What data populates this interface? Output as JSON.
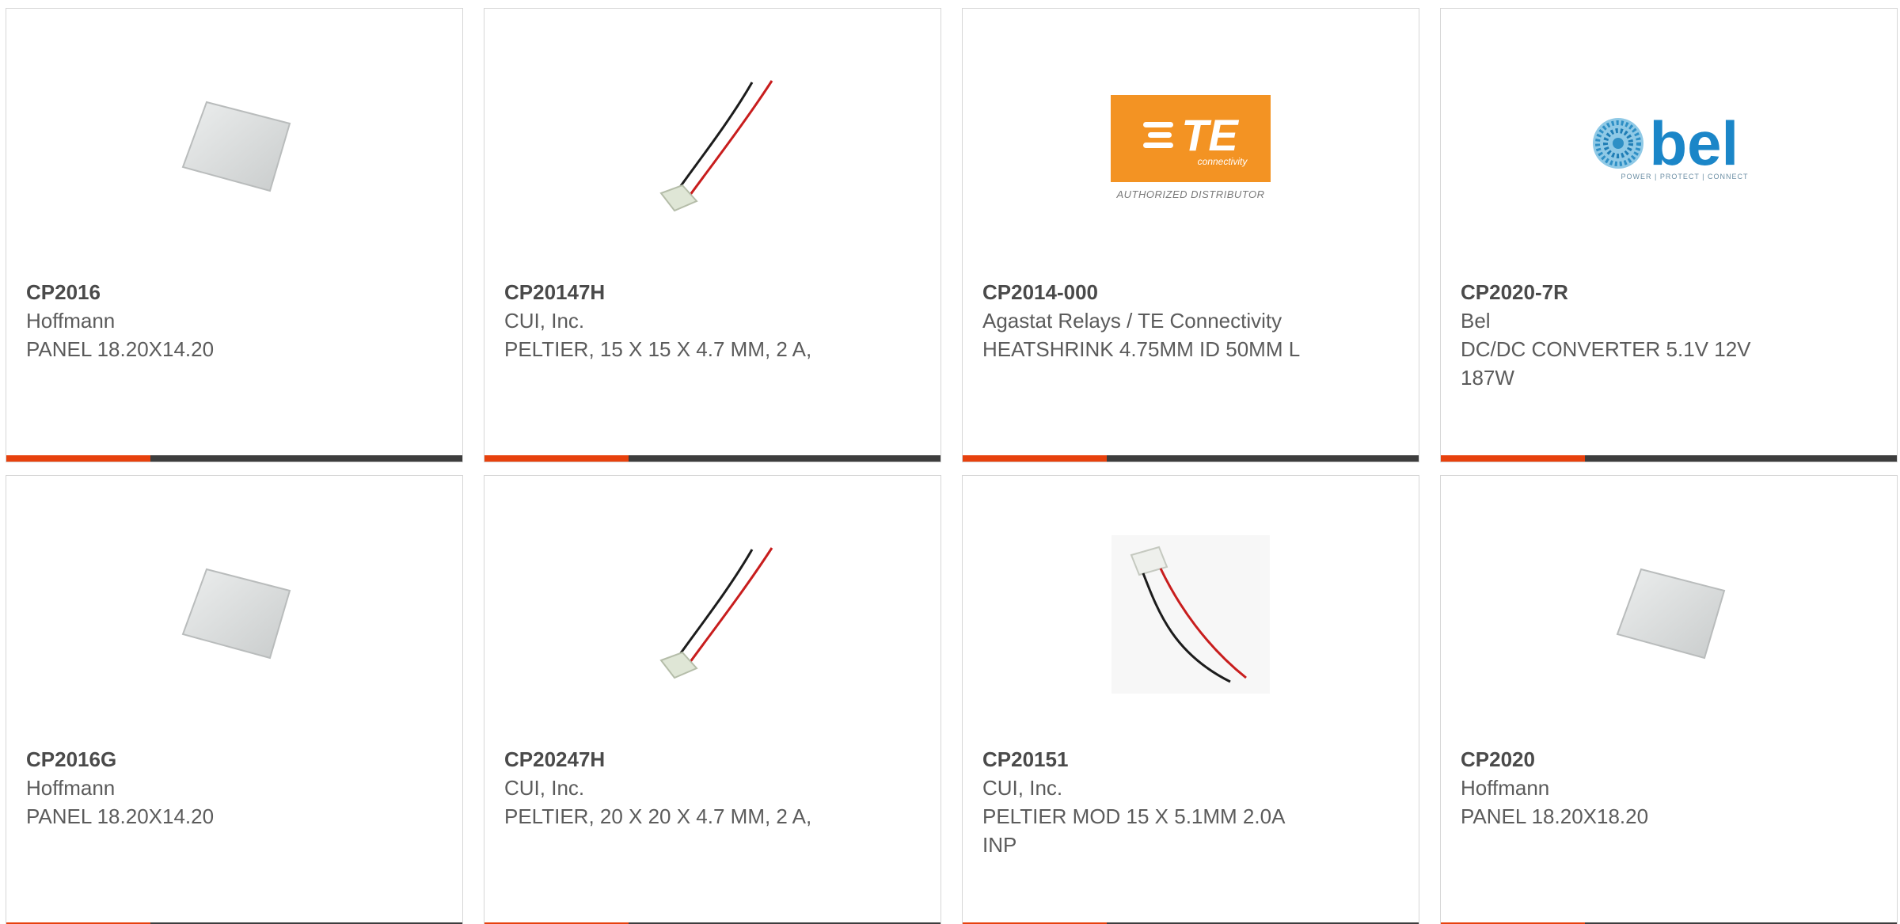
{
  "accent_color": "#e7410d",
  "bar_color": "#3d3d3d",
  "products": [
    {
      "part": "CP2016",
      "maker": "Hoffmann",
      "desc": "PANEL 18.20X14.20",
      "image": "panel-image"
    },
    {
      "part": "CP20147H",
      "maker": "CUI, Inc.",
      "desc": "PELTIER, 15 X 15 X 4.7 MM, 2 A,",
      "image": "peltier-image"
    },
    {
      "part": "CP2014-000",
      "maker": "Agastat Relays / TE Connectivity",
      "desc": "HEATSHRINK 4.75MM ID 50MM L",
      "image": "te-logo",
      "logo_text": "TE",
      "logo_sub": "connectivity",
      "logo_caption": "AUTHORIZED DISTRIBUTOR"
    },
    {
      "part": "CP2020-7R",
      "maker": "Bel",
      "desc": "DC/DC CONVERTER 5.1V 12V 187W",
      "image": "bel-logo",
      "logo_text": "bel",
      "logo_caption": "POWER | PROTECT | CONNECT"
    },
    {
      "part": "CP2016G",
      "maker": "Hoffmann",
      "desc": "PANEL 18.20X14.20",
      "image": "panel-image"
    },
    {
      "part": "CP20247H",
      "maker": "CUI, Inc.",
      "desc": "PELTIER, 20 X 20 X 4.7 MM, 2 A,",
      "image": "peltier-image"
    },
    {
      "part": "CP20151",
      "maker": "CUI, Inc.",
      "desc": "PELTIER MOD 15 X 5.1MM 2.0A INP",
      "image": "peltier-module-image"
    },
    {
      "part": "CP2020",
      "maker": "Hoffmann",
      "desc": "PANEL 18.20X18.20",
      "image": "panel-image"
    }
  ]
}
